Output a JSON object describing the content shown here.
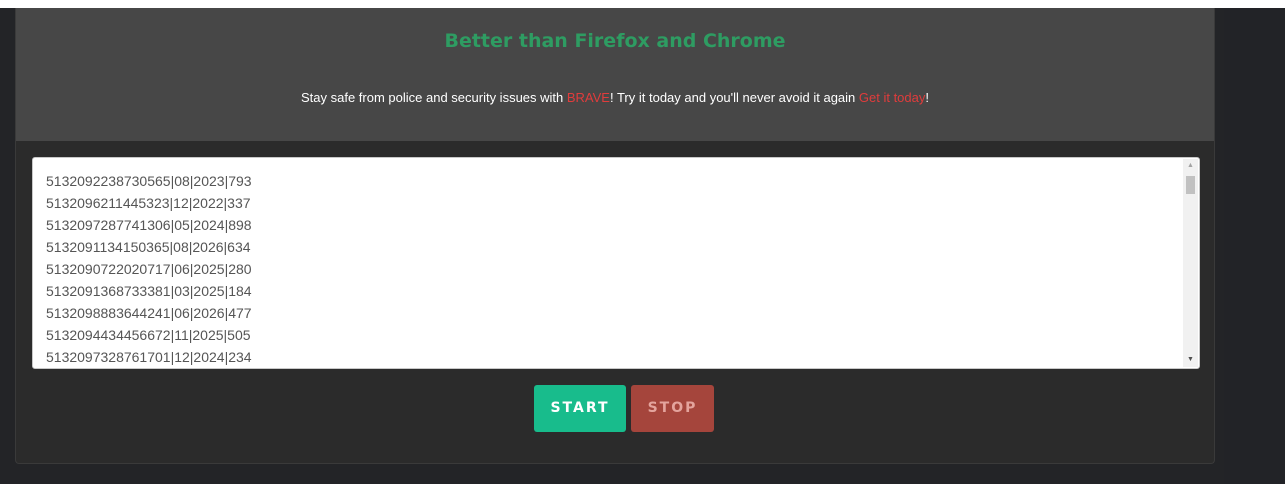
{
  "header": {
    "title": "Better than Firefox and Chrome",
    "promo": {
      "before": "Stay safe from police and security issues with ",
      "brand_link": "BRAVE",
      "middle": "! Try it today and you'll never avoid it again ",
      "cta_link": "Get it today",
      "after": "!"
    }
  },
  "textarea": {
    "lines": [
      "5132092238730565|08|2023|793",
      "5132096211445323|12|2022|337",
      "5132097287741306|05|2024|898",
      "5132091134150365|08|2026|634",
      "5132090722020717|06|2025|280",
      "5132091368733381|03|2025|184",
      "5132098883644241|06|2026|477",
      "5132094434456672|11|2025|505",
      "5132097328761701|12|2024|234"
    ]
  },
  "buttons": {
    "start_label": "START",
    "stop_label": "STOP"
  },
  "colors": {
    "title_green": "#2e9c62",
    "link_red": "#e03c3c",
    "start_button": "#18bc8c",
    "stop_button": "#a5453c"
  },
  "icons": {
    "scroll_up": "scroll-up-arrow-icon",
    "scroll_down": "scroll-down-arrow-icon"
  }
}
